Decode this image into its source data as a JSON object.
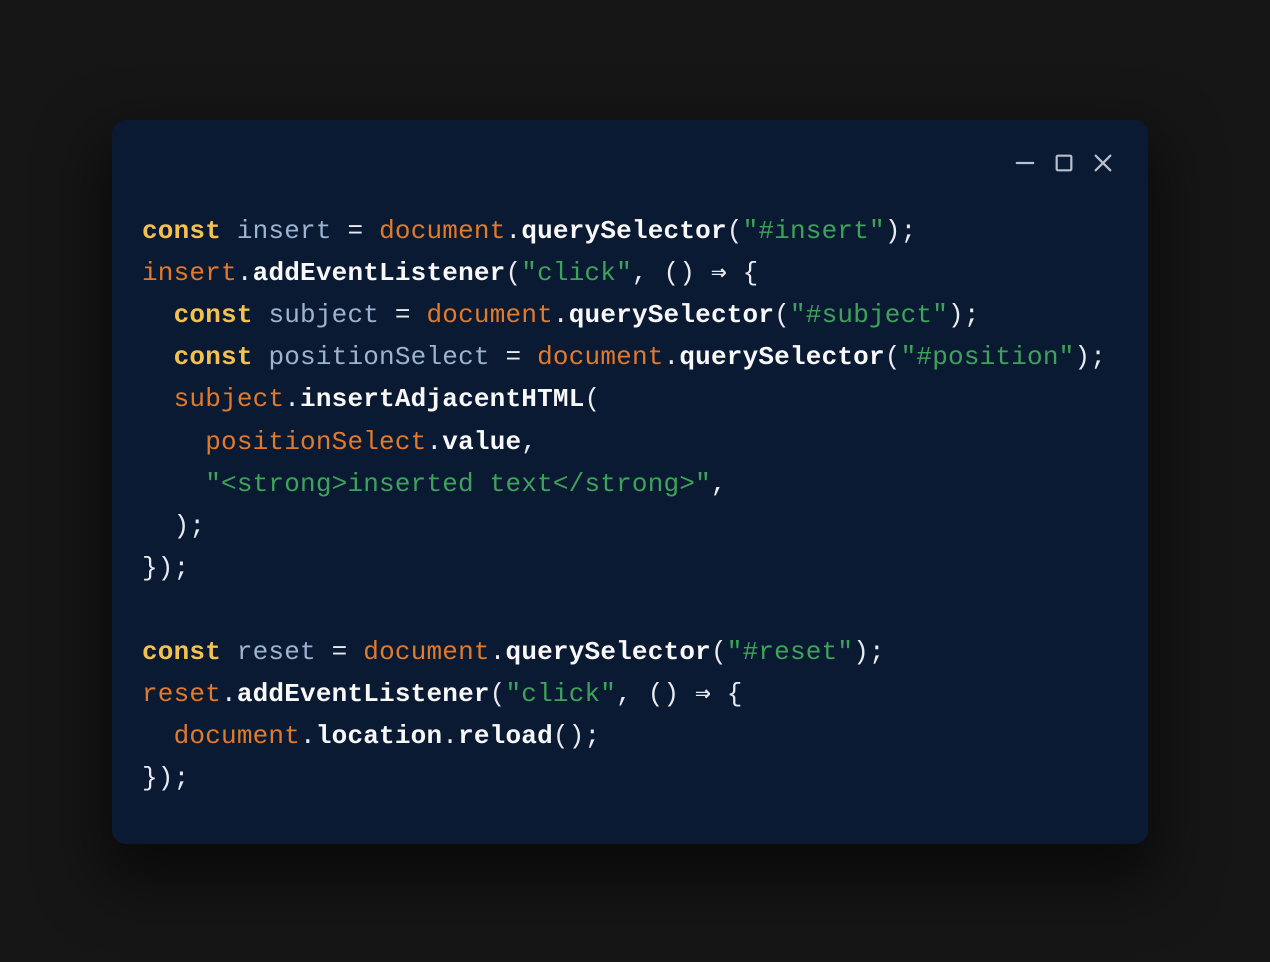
{
  "window": {
    "controls": {
      "minimize": "minimize",
      "maximize": "maximize",
      "close": "close"
    }
  },
  "code": {
    "l1": {
      "kw": "const",
      "var": "insert",
      "eq": "=",
      "obj": "document",
      "dot": ".",
      "fn": "querySelector",
      "open": "(",
      "str": "\"#insert\"",
      "close": ");"
    },
    "l2": {
      "obj": "insert",
      "dot": ".",
      "fn": "addEventListener",
      "open": "(",
      "str": "\"click\"",
      "comma": ", ",
      "paren": "()",
      "arrow": " ⇒ ",
      "brace": "{"
    },
    "l3": {
      "indent": "  ",
      "kw": "const",
      "var": "subject",
      "eq": "=",
      "obj": "document",
      "dot": ".",
      "fn": "querySelector",
      "open": "(",
      "str": "\"#subject\"",
      "close": ");"
    },
    "l4": {
      "indent": "  ",
      "kw": "const",
      "var": "positionSelect",
      "eq": "=",
      "obj": "document",
      "dot": ".",
      "fn": "querySelector",
      "open": "(",
      "str": "\"#position\"",
      "close": ");"
    },
    "l5": {
      "indent": "  ",
      "obj": "subject",
      "dot": ".",
      "fn": "insertAdjacentHTML",
      "open": "("
    },
    "l6": {
      "indent": "    ",
      "obj": "positionSelect",
      "dot": ".",
      "prop": "value",
      "comma": ","
    },
    "l7": {
      "indent": "    ",
      "str": "\"<strong>inserted text</strong>\"",
      "comma": ","
    },
    "l8": {
      "indent": "  ",
      "close": ");"
    },
    "l9": {
      "close": "});"
    },
    "blank": " ",
    "l10": {
      "kw": "const",
      "var": "reset",
      "eq": "=",
      "obj": "document",
      "dot": ".",
      "fn": "querySelector",
      "open": "(",
      "str": "\"#reset\"",
      "close": ");"
    },
    "l11": {
      "obj": "reset",
      "dot": ".",
      "fn": "addEventListener",
      "open": "(",
      "str": "\"click\"",
      "comma": ", ",
      "paren": "()",
      "arrow": " ⇒ ",
      "brace": "{"
    },
    "l12": {
      "indent": "  ",
      "obj": "document",
      "dot": ".",
      "prop1": "location",
      "dot2": ".",
      "fn": "reload",
      "call": "();"
    },
    "l13": {
      "close": "});"
    }
  }
}
